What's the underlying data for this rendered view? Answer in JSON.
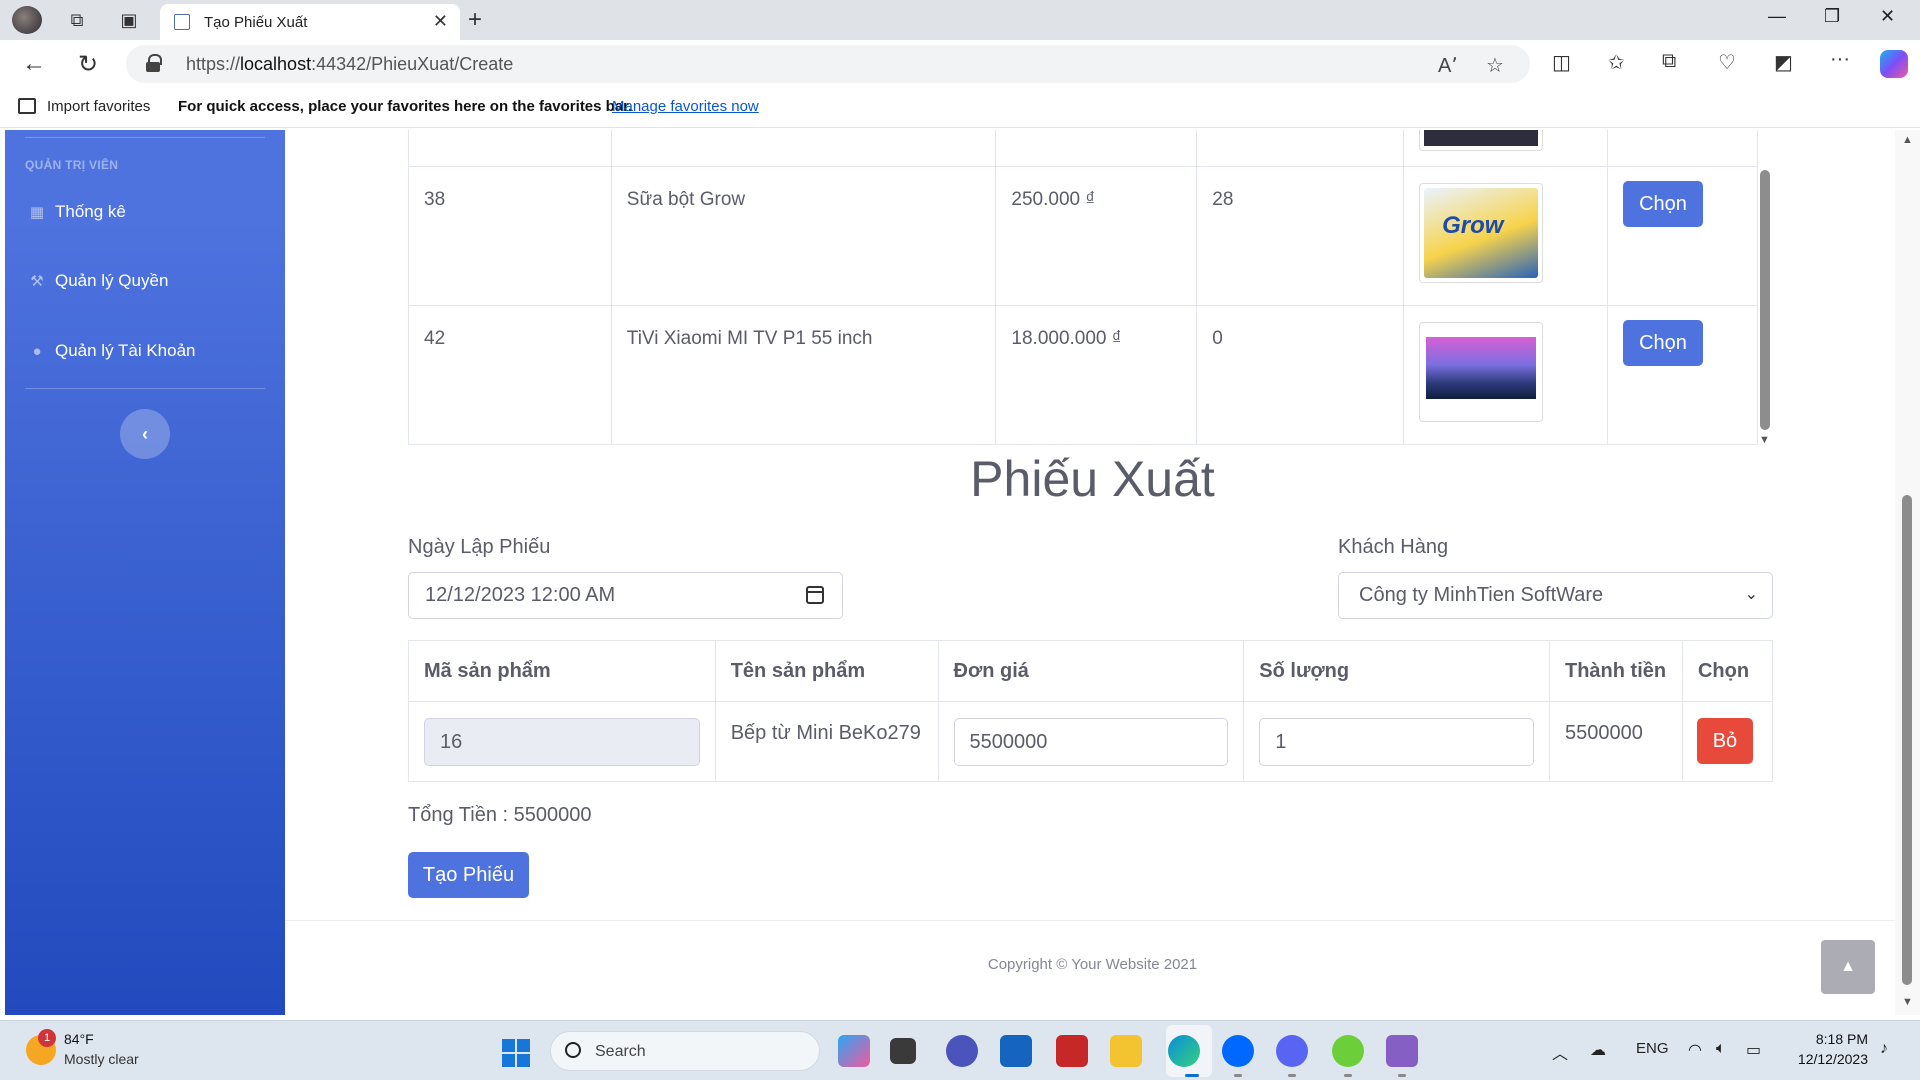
{
  "browser": {
    "tab_title": "Tạo Phiếu Xuất",
    "url_prefix": "https://",
    "url_host": "localhost",
    "url_rest": ":44342/PhieuXuat/Create",
    "favorites": {
      "import_label": "Import favorites",
      "quick_access_text": "For quick access, place your favorites here on the favorites bar.",
      "manage_link": "Manage favorites now"
    }
  },
  "sidebar": {
    "heading": "QUẢN TRỊ VIÊN",
    "items": [
      {
        "label": "Thống kê",
        "icon": "calculator-icon"
      },
      {
        "label": "Quản lý Quyền",
        "icon": "hammer-icon"
      },
      {
        "label": "Quản lý Tài Khoản",
        "icon": "user-icon"
      }
    ],
    "toggle_icon": "‹"
  },
  "products": {
    "rows": [
      {
        "id": "38",
        "name": "Sữa bột Grow",
        "price": "250.000 ₫",
        "stock": "28",
        "image": "Grow",
        "action": "Chọn"
      },
      {
        "id": "42",
        "name": "TiVi Xiaomi MI TV P1 55 inch",
        "price": "18.000.000 ₫",
        "stock": "0",
        "image": "tv",
        "action": "Chọn"
      }
    ]
  },
  "form": {
    "title": "Phiếu Xuất",
    "date_label": "Ngày Lập Phiếu",
    "date_value": "12/12/2023 12:00  AM",
    "customer_label": "Khách Hàng",
    "customer_value": "Công ty MinhTien SoftWare"
  },
  "order": {
    "headers": [
      "Mã sản phẩm",
      "Tên sản phẩm",
      "Đơn giá",
      "Số lượng",
      "Thành tiền",
      "Chọn"
    ],
    "rows": [
      {
        "product_id": "16",
        "product_name": "Bếp từ Mini BeKo279",
        "unit_price": "5500000",
        "quantity": "1",
        "line_total": "5500000",
        "remove_label": "Bỏ"
      }
    ],
    "total_text": "Tổng Tiền : 5500000",
    "submit_label": "Tạo Phiếu"
  },
  "footer": {
    "copyright": "Copyright © Your Website 2021"
  },
  "taskbar": {
    "weather_temp": "84°F",
    "weather_desc": "Mostly clear",
    "weather_badge": "1",
    "search_label": "Search",
    "language": "ENG",
    "time": "8:18 PM",
    "date": "12/12/2023"
  },
  "colors": {
    "primary": "#4e73df",
    "danger": "#e74a3b",
    "sidebar_top": "#4e73df",
    "sidebar_bottom": "#224abe"
  }
}
